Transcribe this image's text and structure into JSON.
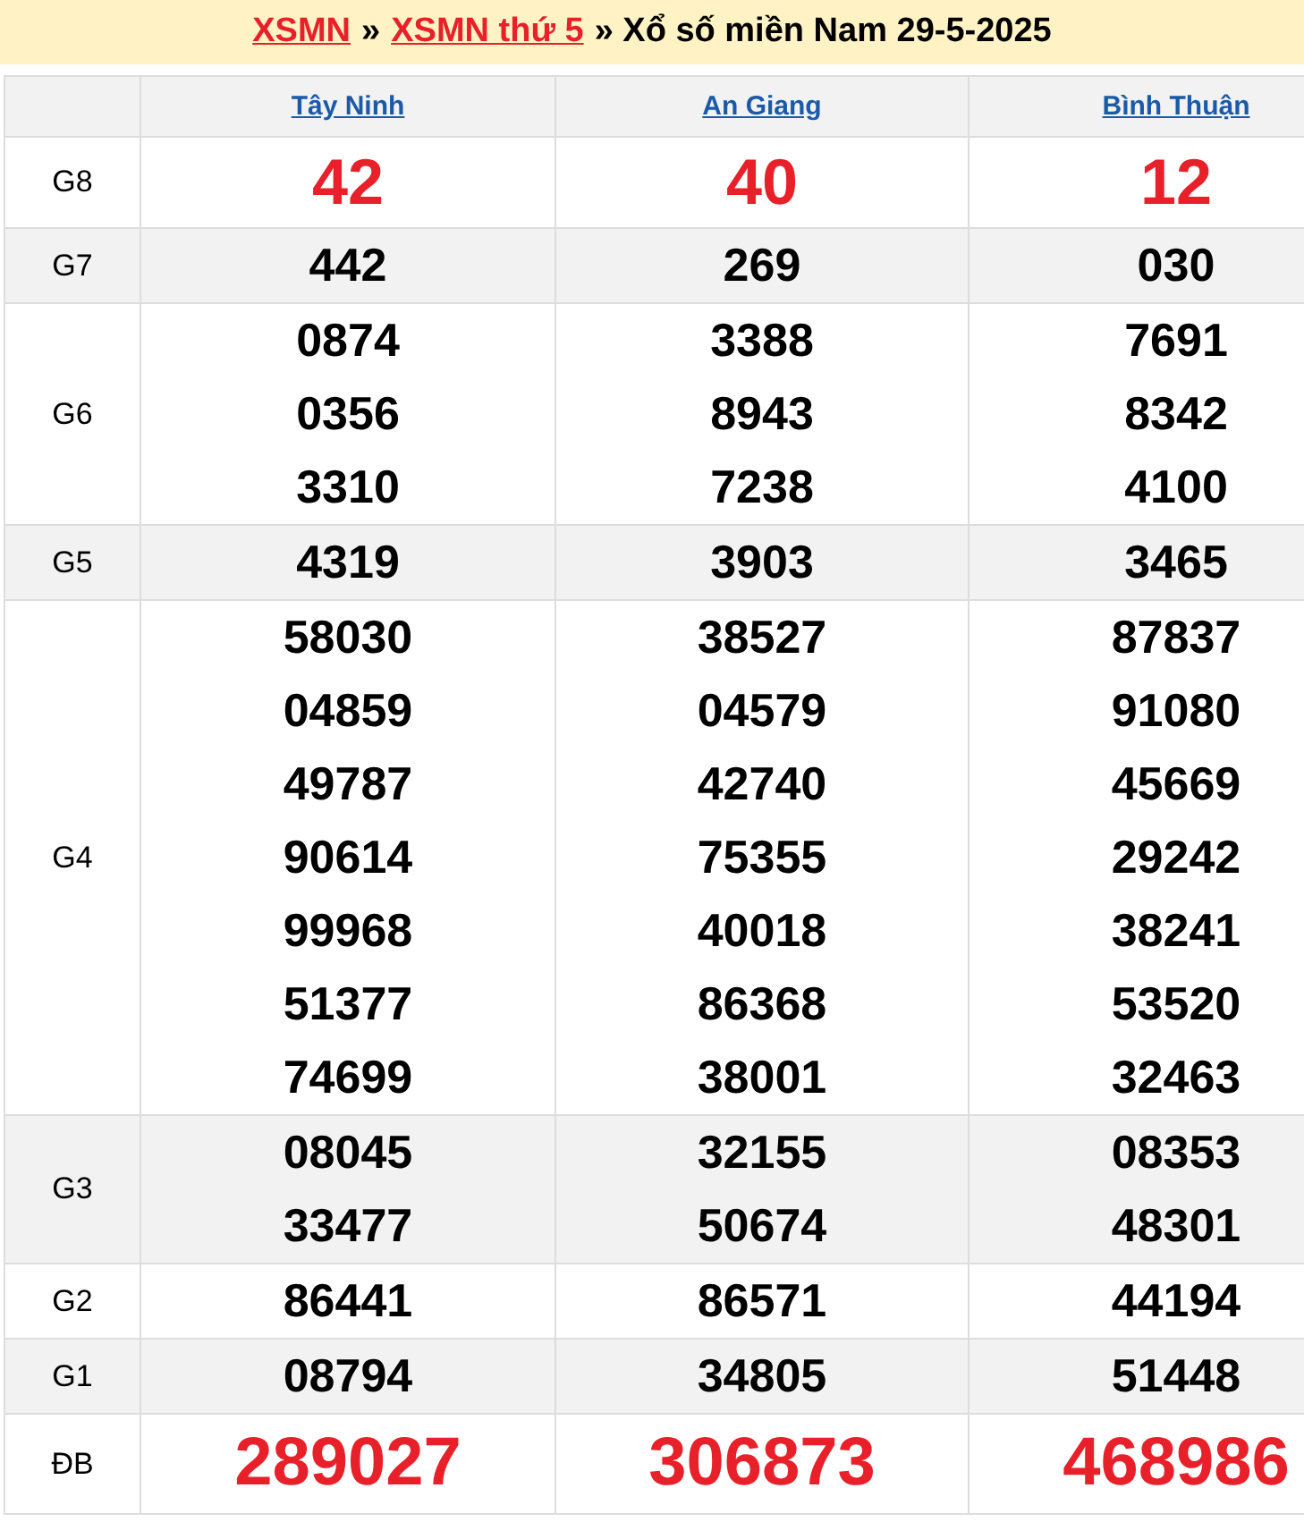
{
  "header": {
    "parts": [
      {
        "kind": "link",
        "text": "XSMN"
      },
      {
        "kind": "text",
        "text": "»"
      },
      {
        "kind": "link",
        "text": "XSMN thứ 5"
      },
      {
        "kind": "text",
        "text": "» Xổ số miền Nam 29-5-2025"
      }
    ]
  },
  "provinces": [
    "Tây Ninh",
    "An Giang",
    "Bình Thuận"
  ],
  "prizes": [
    {
      "label": "G8",
      "kind": "big",
      "shaded": false,
      "numbers": [
        [
          "42"
        ],
        [
          "40"
        ],
        [
          "12"
        ]
      ]
    },
    {
      "label": "G7",
      "kind": "normal",
      "shaded": true,
      "numbers": [
        [
          "442"
        ],
        [
          "269"
        ],
        [
          "030"
        ]
      ]
    },
    {
      "label": "G6",
      "kind": "normal",
      "shaded": false,
      "numbers": [
        [
          "0874",
          "0356",
          "3310"
        ],
        [
          "3388",
          "8943",
          "7238"
        ],
        [
          "7691",
          "8342",
          "4100"
        ]
      ]
    },
    {
      "label": "G5",
      "kind": "normal",
      "shaded": true,
      "numbers": [
        [
          "4319"
        ],
        [
          "3903"
        ],
        [
          "3465"
        ]
      ]
    },
    {
      "label": "G4",
      "kind": "normal",
      "shaded": false,
      "numbers": [
        [
          "58030",
          "04859",
          "49787",
          "90614",
          "99968",
          "51377",
          "74699"
        ],
        [
          "38527",
          "04579",
          "42740",
          "75355",
          "40018",
          "86368",
          "38001"
        ],
        [
          "87837",
          "91080",
          "45669",
          "29242",
          "38241",
          "53520",
          "32463"
        ]
      ]
    },
    {
      "label": "G3",
      "kind": "normal",
      "shaded": true,
      "numbers": [
        [
          "08045",
          "33477"
        ],
        [
          "32155",
          "50674"
        ],
        [
          "08353",
          "48301"
        ]
      ]
    },
    {
      "label": "G2",
      "kind": "normal",
      "shaded": false,
      "numbers": [
        [
          "86441"
        ],
        [
          "86571"
        ],
        [
          "44194"
        ]
      ]
    },
    {
      "label": "G1",
      "kind": "normal",
      "shaded": true,
      "numbers": [
        [
          "08794"
        ],
        [
          "34805"
        ],
        [
          "51448"
        ]
      ]
    },
    {
      "label": "ĐB",
      "kind": "big",
      "shaded": false,
      "numbers": [
        [
          "289027"
        ],
        [
          "306873"
        ],
        [
          "468986"
        ]
      ]
    }
  ]
}
